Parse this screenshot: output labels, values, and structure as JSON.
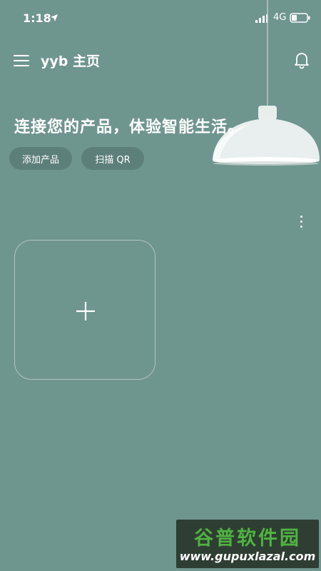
{
  "status_bar": {
    "time": "1:18",
    "network": "4G"
  },
  "header": {
    "title": "yyb 主页"
  },
  "main": {
    "headline": "连接您的产品，体验智能生活。",
    "buttons": {
      "add_product": "添加产品",
      "scan_qr": "扫描 QR"
    }
  },
  "watermark": {
    "name": "谷普软件园",
    "url": "www.gupuxlazal.com"
  },
  "colors": {
    "background": "#6f958f",
    "pill": "#5c7f79",
    "watermark_green": "#4fb341"
  },
  "icons": [
    "location-arrow-icon",
    "signal-icon",
    "battery-icon",
    "menu-icon",
    "bell-icon",
    "more-vertical-icon",
    "plus-icon"
  ]
}
